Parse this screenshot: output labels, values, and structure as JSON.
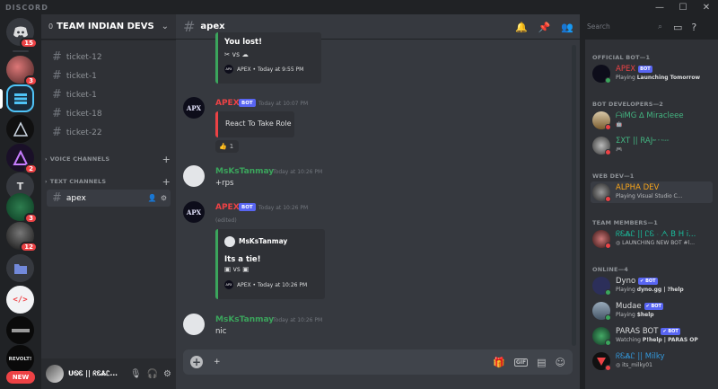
{
  "app": {
    "brand": "DISCORD"
  },
  "window": {
    "minimize": "—",
    "maximize": "☐",
    "close": "✕"
  },
  "servers": [
    {
      "label": "",
      "badge": "15"
    },
    {
      "label": "",
      "badge": "3"
    },
    {
      "label": "",
      "badge": ""
    },
    {
      "label": "",
      "badge": ""
    },
    {
      "label": "",
      "badge": "2"
    },
    {
      "label": "T",
      "badge": ""
    },
    {
      "label": "",
      "badge": "3"
    },
    {
      "label": "",
      "badge": "12"
    },
    {
      "label": "",
      "badge": ""
    },
    {
      "label": "</>",
      "badge": ""
    },
    {
      "label": "",
      "badge": ""
    },
    {
      "label": "REVOLT!",
      "badge": ""
    }
  ],
  "new_badge": "NEW",
  "guild": {
    "mention_count": "0",
    "name": "TEAM INDIAN DEVS"
  },
  "channels": [
    "ticket-12",
    "ticket-1",
    "ticket-1",
    "ticket-18",
    "ticket-22"
  ],
  "categories": {
    "voice": "VOICE CHANNELS",
    "text": "TEXT CHANNELS"
  },
  "active_channel": "apex",
  "user": {
    "name": "ᑌᏫᏋ || ᖇᏋᏜᏝ..."
  },
  "chat_header": {
    "channel": "apex"
  },
  "search": {
    "placeholder": "Search"
  },
  "messages": {
    "embed1": {
      "title": "You lost!",
      "vs": "vs",
      "footer": "APEX • Today at 9:55 PM"
    },
    "m1": {
      "author": "APEX",
      "bot": "BOT",
      "time": "Today at 10:07 PM",
      "embed_text": "React To Take Role",
      "reaction_count": "1"
    },
    "m2": {
      "author": "MsKsTanmay",
      "time": "Today at 10:26 PM",
      "text": "+rps"
    },
    "m3": {
      "author": "APEX",
      "bot": "BOT",
      "time": "Today at 10:26 PM",
      "edited": "(edited)",
      "embed_author": "MsKsTanmay",
      "embed_title": "Its a tie!",
      "vs": "vs",
      "footer": "APEX • Today at 10:26 PM"
    },
    "m4": {
      "author": "MsKsTanmay",
      "time": "Today at 10:26 PM",
      "text": "nic"
    }
  },
  "composer": {
    "value": "+"
  },
  "avatar_text": "APX",
  "members": {
    "official_bot_header": "OFFICIAL BOT—1",
    "bot_dev_header": "BOT DEVELOPERS—2",
    "web_dev_header": "WEB DEV—1",
    "team_header": "TEAM MEMBERS—1",
    "online_header": "ONLINE—4",
    "list": [
      {
        "name": "APEX",
        "bot": "BOT",
        "activity_prefix": "Playing ",
        "activity": "Launching Tomorrow"
      },
      {
        "name": "ᗩiMG ∆ Miracleee",
        "activity_prefix": "",
        "activity": ""
      },
      {
        "name": "ΣXT || RAJ",
        "suffix": "ᴮᴱ ᵀ ᵀᵒˣⁱᶜ",
        "activity_prefix": "",
        "activity": ""
      },
      {
        "name": "ALPHA DEV",
        "activity_prefix": "Playing ",
        "activity": "Visual Studio C..."
      },
      {
        "name": "ᖇᏋᏜᏝ || ᏝᏋ ⸱ ᗅ B H i...",
        "activity_prefix": "",
        "activity": "LAUNCHING NEW BOT #l..."
      },
      {
        "name": "Dyno",
        "bot": "✔ BOT",
        "activity_prefix": "Playing ",
        "activity": "dyno.gg | ?help"
      },
      {
        "name": "Mudae",
        "bot": "✔ BOT",
        "activity_prefix": "Playing ",
        "activity": "$help"
      },
      {
        "name": "PARAS BOT",
        "bot": "✔ BOT",
        "activity_prefix": "Watching ",
        "activity": "P!help | PARAS OP"
      },
      {
        "name": "ᖇᏋᏜᏝ || Milky",
        "activity_prefix": "",
        "activity": "its_milky01"
      }
    ]
  },
  "colors": {
    "apex_red": "#ed4245",
    "tanmay_green": "#3ba55c",
    "dev_green": "#43b581",
    "alpha_yellow": "#faa61a",
    "team_teal": "#1abc9c",
    "milky_blue": "#3498db"
  }
}
